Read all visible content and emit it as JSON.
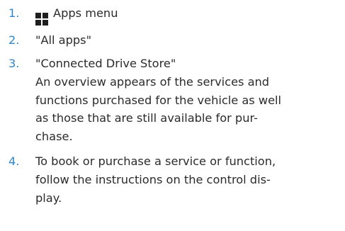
{
  "steps": [
    {
      "number": "1.",
      "icon": "apps-grid-icon",
      "text": "Apps menu"
    },
    {
      "number": "2.",
      "text": "\"All apps\""
    },
    {
      "number": "3.",
      "text": "\"Connected Drive Store\""
    },
    {
      "number": "4.",
      "lines": [
        "To book or purchase a service or function,",
        "follow the instructions on the control dis-",
        "play."
      ]
    }
  ],
  "note": {
    "lines": [
      "An overview appears of the services and",
      "functions purchased for the vehicle as well",
      "as those that are still available for pur-",
      "chase."
    ]
  },
  "colors": {
    "step_number": "#2f86c9",
    "text": "#2b2b2b",
    "icon": "#1f1f1f"
  }
}
